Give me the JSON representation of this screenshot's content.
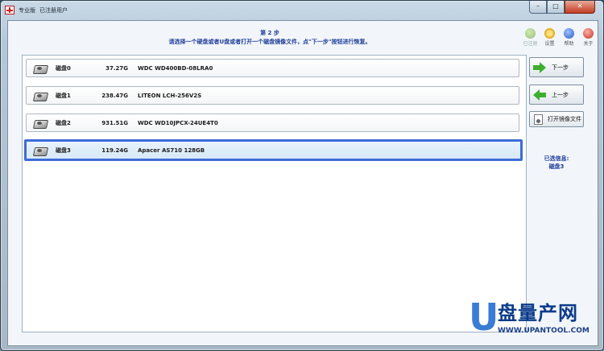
{
  "window": {
    "edition": "专业版",
    "registered_label": "已注册用户",
    "controls": {
      "minimize": "–",
      "maximize": "□",
      "close": "✕"
    }
  },
  "header": {
    "step_title": "第 2 步",
    "step_desc": "请选择一个硬盘或者U盘或者打开一个磁盘镜像文件，点\"下一步\"按钮进行恢复。"
  },
  "toolbar": {
    "items": [
      {
        "label": "已注册",
        "icon": "register-icon",
        "enabled": false
      },
      {
        "label": "设置",
        "icon": "settings-icon",
        "enabled": true
      },
      {
        "label": "帮助",
        "icon": "help-icon",
        "enabled": true
      },
      {
        "label": "关于",
        "icon": "about-icon",
        "enabled": true
      }
    ]
  },
  "disks": [
    {
      "name": "磁盘0",
      "size": "37.27G",
      "model": "WDC WD400BD-08LRA0",
      "selected": false
    },
    {
      "name": "磁盘1",
      "size": "238.47G",
      "model": "LITEON LCH-256V2S",
      "selected": false
    },
    {
      "name": "磁盘2",
      "size": "931.51G",
      "model": "WDC WD10JPCX-24UE4T0",
      "selected": false
    },
    {
      "name": "磁盘3",
      "size": "119.24G",
      "model": "Apacer AS710 128GB",
      "selected": true
    }
  ],
  "buttons": {
    "next": "下一步",
    "prev": "上一步",
    "open_image": "打开镜像文件"
  },
  "selected_info": {
    "label": "已选信息:",
    "value": "磁盘3"
  },
  "watermark": {
    "letter": "U",
    "title": "盘量产网",
    "url": "WWW.UPANTOOL.COM"
  }
}
